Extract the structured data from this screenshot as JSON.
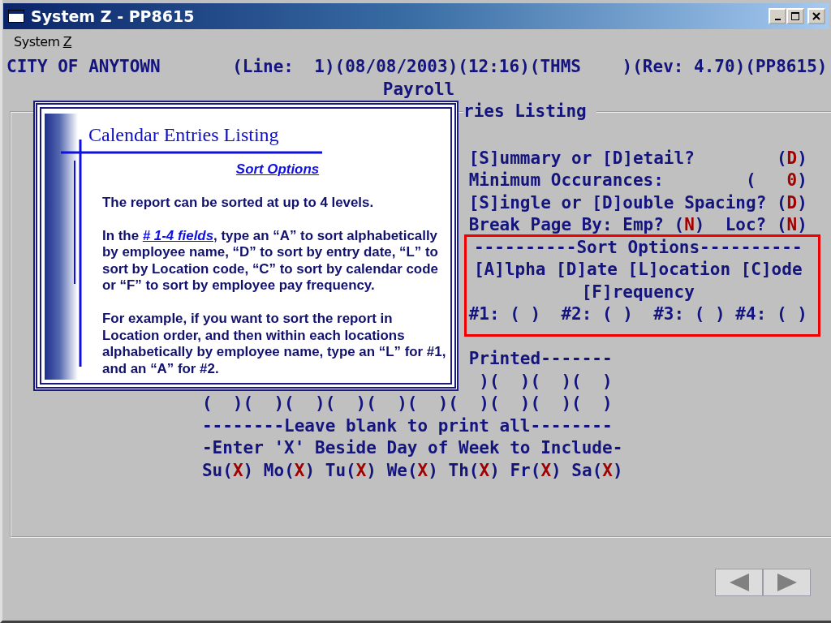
{
  "window": {
    "title": "System Z - PP8615"
  },
  "menu": [
    {
      "label": "System",
      "accelerator": "Z"
    }
  ],
  "terminal": {
    "header": "CITY OF ANYTOWN       (Line:  1)(08/08/2003)(12:16)(THMS    )(Rev: 4.70)(PP8615)",
    "subtitle": "Payroll",
    "group_title": "ries Listing",
    "prompts": [
      {
        "kind": "choice",
        "items": [
          {
            "label": "[S]ummary or [D]etail?",
            "open": "(",
            "value": "D",
            "close": ")"
          }
        ]
      },
      {
        "kind": "number",
        "items": [
          {
            "label": "Minimum Occurances:",
            "open": "(",
            "value": "0",
            "close": ")"
          }
        ]
      },
      {
        "kind": "choice",
        "items": [
          {
            "label": "[S]ingle or [D]ouble Spacing?",
            "open": "(",
            "value": "D",
            "close": ")"
          }
        ]
      },
      {
        "kind": "pair",
        "items": [
          {
            "label": "Break Page By: Emp?",
            "open": "(",
            "value": "N",
            "close": ")"
          },
          {
            "label": "Loc?",
            "open": "(",
            "value": "N",
            "close": ")"
          }
        ]
      }
    ],
    "sort_box": {
      "lines": [
        "----------Sort Options----------",
        "[A]lpha [D]ate [L]ocation [C]ode",
        "[F]requency"
      ],
      "levels": "#1: ( )  #2: ( )  #3: ( ) #4: ( )"
    },
    "print_lines": [
      {
        "kind": "tail",
        "text": "Printed-------"
      },
      {
        "kind": "tail",
        "text": ")(  )(  )(  )"
      },
      {
        "kind": "full",
        "text": "(  )(  )(  )(  )(  )(  )(  )(  )(  )(  )"
      },
      {
        "kind": "full",
        "text": "--------Leave blank to print all--------"
      },
      {
        "kind": "full",
        "text": "-Enter 'X' Beside Day of Week to Include-"
      }
    ],
    "days": [
      {
        "label": "Su",
        "open": "(",
        "value": "X",
        "close": ")"
      },
      {
        "label": "Mo",
        "open": "(",
        "value": "X",
        "close": ")"
      },
      {
        "label": "Tu",
        "open": "(",
        "value": "X",
        "close": ")"
      },
      {
        "label": "We",
        "open": "(",
        "value": "X",
        "close": ")"
      },
      {
        "label": "Th",
        "open": "(",
        "value": "X",
        "close": ")"
      },
      {
        "label": "Fr",
        "open": "(",
        "value": "X",
        "close": ")"
      },
      {
        "label": "Sa",
        "open": "(",
        "value": "X",
        "close": ")"
      }
    ]
  },
  "help": {
    "title": "Calendar Entries Listing",
    "subtitle": "Sort Options",
    "paragraphs": [
      {
        "text": "The report can be sorted at up to 4 levels."
      },
      {
        "before": "In the ",
        "link": "# 1-4 fields",
        "after": ", type an “A” to sort alphabetically by employee name, “D” to sort by entry date, “L” to sort by Location code, “C” to sort by calendar code or “F” to sort by employee pay frequency."
      },
      {
        "text": "For example, if you want to sort the report in Location order, and then within each locations alphabetically by employee name, type an “L” for #1, and an “A” for #2."
      }
    ]
  }
}
